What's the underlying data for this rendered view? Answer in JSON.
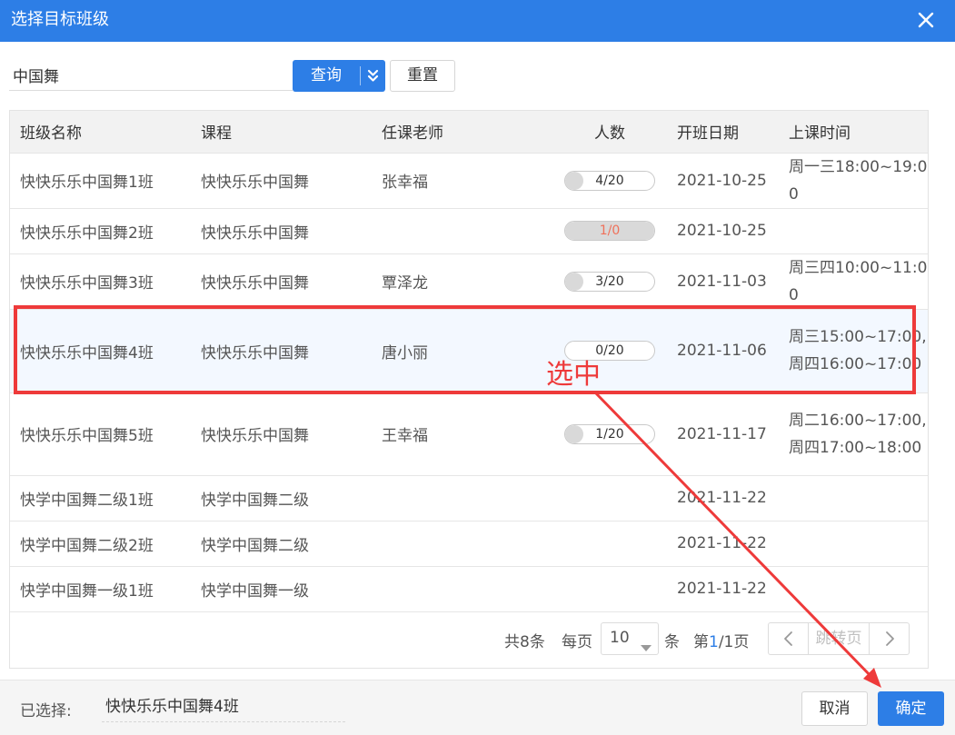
{
  "dialog": {
    "title": "选择目标班级"
  },
  "search": {
    "value": "中国舞",
    "query_label": "查询",
    "reset_label": "重置"
  },
  "table": {
    "headers": [
      "班级名称",
      "课程",
      "任课老师",
      "人数",
      "开班日期",
      "上课时间"
    ],
    "rows": [
      {
        "name": "快快乐乐中国舞1班",
        "course": "快快乐乐中国舞",
        "teacher": "张幸福",
        "count": "4/20",
        "fill": 0.2,
        "date": "2021-10-25",
        "time": "周一三18:00~19:00"
      },
      {
        "name": "快快乐乐中国舞2班",
        "course": "快快乐乐中国舞",
        "teacher": "",
        "count": "1/0",
        "fill": 1.0,
        "date": "2021-10-25",
        "time": ""
      },
      {
        "name": "快快乐乐中国舞3班",
        "course": "快快乐乐中国舞",
        "teacher": "覃泽龙",
        "count": "3/20",
        "fill": 0.15,
        "date": "2021-11-03",
        "time": "周三四10:00~11:00"
      },
      {
        "name": "快快乐乐中国舞4班",
        "course": "快快乐乐中国舞",
        "teacher": "唐小丽",
        "count": "0/20",
        "fill": 0.0,
        "date": "2021-11-06",
        "time": "周三15:00~17:00,周四16:00~17:00"
      },
      {
        "name": "快快乐乐中国舞5班",
        "course": "快快乐乐中国舞",
        "teacher": "王幸福",
        "count": "1/20",
        "fill": 0.05,
        "date": "2021-11-17",
        "time": "周二16:00~17:00,周四17:00~18:00"
      },
      {
        "name": "快学中国舞二级1班",
        "course": "快学中国舞二级",
        "teacher": "",
        "count": "",
        "fill": null,
        "date": "2021-11-22",
        "time": ""
      },
      {
        "name": "快学中国舞二级2班",
        "course": "快学中国舞二级",
        "teacher": "",
        "count": "",
        "fill": null,
        "date": "2021-11-22",
        "time": ""
      },
      {
        "name": "快学中国舞一级1班",
        "course": "快学中国舞一级",
        "teacher": "",
        "count": "",
        "fill": null,
        "date": "2021-11-22",
        "time": ""
      }
    ],
    "selected_index": 3
  },
  "pager": {
    "total": "共8条",
    "per_page_label": "每页",
    "page_size": "10",
    "unit": "条",
    "page_prefix": "第",
    "current": "1",
    "page_suffix": "/1页",
    "jump_label": "跳转页"
  },
  "footer": {
    "selected_label": "已选择:",
    "selected_value": "快快乐乐中国舞4班",
    "cancel_label": "取消",
    "ok_label": "确定"
  },
  "annotation": {
    "text": "选中",
    "color": "#ee3a3a"
  },
  "colors": {
    "primary": "#2d7ee6",
    "header_bg": "#f2f2f2",
    "selected_row": "#f3f8ff",
    "full_count": "#f0715a"
  }
}
